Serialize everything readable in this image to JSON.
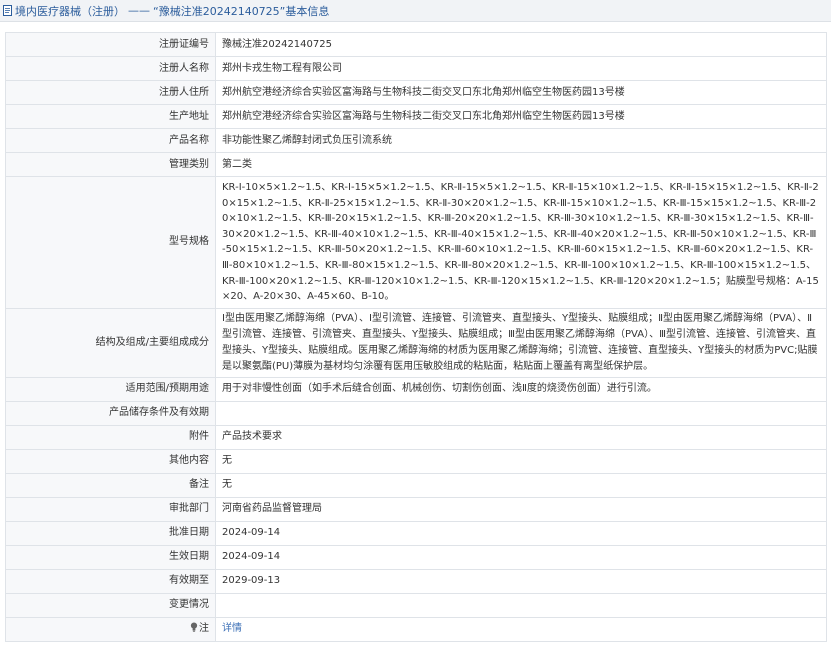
{
  "header": {
    "crumb": "境内医疗器械（注册）",
    "sep": "——",
    "sub": "“豫械注准20242140725”基本信息"
  },
  "rows": [
    {
      "label": "注册证编号",
      "value": "豫械注准20242140725"
    },
    {
      "label": "注册人名称",
      "value": "郑州卡戎生物工程有限公司"
    },
    {
      "label": "注册人住所",
      "value": "郑州航空港经济综合实验区富海路与生物科技二街交叉口东北角郑州临空生物医药园13号楼"
    },
    {
      "label": "生产地址",
      "value": "郑州航空港经济综合实验区富海路与生物科技二街交叉口东北角郑州临空生物医药园13号楼"
    },
    {
      "label": "产品名称",
      "value": "非功能性聚乙烯醇封闭式负压引流系统"
    },
    {
      "label": "管理类别",
      "value": "第二类"
    },
    {
      "label": "型号规格",
      "value": "KR-Ⅰ-10×5×1.2~1.5、KR-Ⅰ-15×5×1.2~1.5、KR-Ⅱ-15×5×1.2~1.5、KR-Ⅱ-15×10×1.2~1.5、KR-Ⅱ-15×15×1.2~1.5、KR-Ⅱ-20×15×1.2~1.5、KR-Ⅱ-25×15×1.2~1.5、KR-Ⅱ-30×20×1.2~1.5、KR-Ⅲ-15×10×1.2~1.5、KR-Ⅲ-15×15×1.2~1.5、KR-Ⅲ-20×10×1.2~1.5、KR-Ⅲ-20×15×1.2~1.5、KR-Ⅲ-20×20×1.2~1.5、KR-Ⅲ-30×10×1.2~1.5、KR-Ⅲ-30×15×1.2~1.5、KR-Ⅲ-30×20×1.2~1.5、KR-Ⅲ-40×10×1.2~1.5、KR-Ⅲ-40×15×1.2~1.5、KR-Ⅲ-40×20×1.2~1.5、KR-Ⅲ-50×10×1.2~1.5、KR-Ⅲ-50×15×1.2~1.5、KR-Ⅲ-50×20×1.2~1.5、KR-Ⅲ-60×10×1.2~1.5、KR-Ⅲ-60×15×1.2~1.5、KR-Ⅲ-60×20×1.2~1.5、KR-Ⅲ-80×10×1.2~1.5、KR-Ⅲ-80×15×1.2~1.5、KR-Ⅲ-80×20×1.2~1.5、KR-Ⅲ-100×10×1.2~1.5、KR-Ⅲ-100×15×1.2~1.5、KR-Ⅲ-100×20×1.2~1.5、KR-Ⅲ-120×10×1.2~1.5、KR-Ⅲ-120×15×1.2~1.5、KR-Ⅲ-120×20×1.2~1.5；贴膜型号规格：A-15×20、A-20×30、A-45×60、B-10。"
    },
    {
      "label": "结构及组成/主要组成成分",
      "value": "Ⅰ型由医用聚乙烯醇海绵（PVA）、Ⅰ型引流管、连接管、引流管夹、直型接头、Y型接头、贴膜组成；Ⅱ型由医用聚乙烯醇海绵（PVA）、Ⅱ型引流管、连接管、引流管夹、直型接头、Y型接头、贴膜组成；Ⅲ型由医用聚乙烯醇海绵（PVA）、Ⅲ型引流管、连接管、引流管夹、直型接头、Y型接头、贴膜组成。医用聚乙烯醇海绵的材质为医用聚乙烯醇海绵；引流管、连接管、直型接头、Y型接头的材质为PVC;贴膜是以聚氨酯(PU)薄膜为基材均匀涂覆有医用压敏胶组成的粘贴面，粘贴面上覆盖有离型纸保护层。"
    },
    {
      "label": "适用范围/预期用途",
      "value": "用于对非慢性创面（如手术后缝合创面、机械创伤、切割伤创面、浅Ⅱ度的烧烫伤创面）进行引流。"
    },
    {
      "label": "产品储存条件及有效期",
      "value": ""
    },
    {
      "label": "附件",
      "value": "产品技术要求"
    },
    {
      "label": "其他内容",
      "value": "无"
    },
    {
      "label": "备注",
      "value": "无"
    },
    {
      "label": "审批部门",
      "value": "河南省药品监督管理局"
    },
    {
      "label": "批准日期",
      "value": "2024-09-14"
    },
    {
      "label": "生效日期",
      "value": "2024-09-14"
    },
    {
      "label": "有效期至",
      "value": "2029-09-13"
    },
    {
      "label": "变更情况",
      "value": ""
    }
  ],
  "footer_row": {
    "icon": "lightbulb-icon",
    "label": "注",
    "link": "详情"
  },
  "colors": {
    "header_bg": "#f1f3f6",
    "header_text": "#2c5d9c",
    "label_bg": "#f7f8fa",
    "border": "#dfe3e8",
    "link": "#3b6fb6"
  }
}
